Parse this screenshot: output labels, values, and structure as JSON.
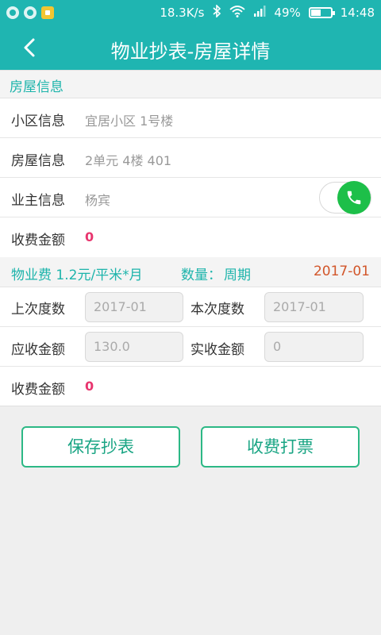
{
  "status": {
    "speed": "18.3K/s",
    "battery": "49%",
    "battery_level": 0.49,
    "time": "14:48"
  },
  "header": {
    "title": "物业抄表-房屋详情"
  },
  "house": {
    "section_title": "房屋信息",
    "rows": [
      {
        "label": "小区信息",
        "value": "宜居小区 1号楼"
      },
      {
        "label": "房屋信息",
        "value": "2单元 4楼 401"
      },
      {
        "label": "业主信息",
        "value": "杨宾"
      },
      {
        "label": "收费金额",
        "value": "0"
      }
    ]
  },
  "fee": {
    "name": "物业费 1.2元/平米*月",
    "qty_label": "数量：",
    "qty_value": "周期",
    "period": "2017-01"
  },
  "meter": {
    "last_label": "上次度数",
    "last_value": "2017-01",
    "this_label": "本次度数",
    "this_value": "2017-01",
    "due_label": "应收金额",
    "due_value": "130.0",
    "paid_label": "实收金额",
    "paid_value": "0",
    "charge_label": "收费金额",
    "charge_value": "0"
  },
  "actions": {
    "save": "保存抄表",
    "charge": "收费打票"
  },
  "colors": {
    "accent": "#1fb5b1",
    "amount": "#e8366f",
    "call": "#1dbf49",
    "button_border": "#2cb885"
  }
}
